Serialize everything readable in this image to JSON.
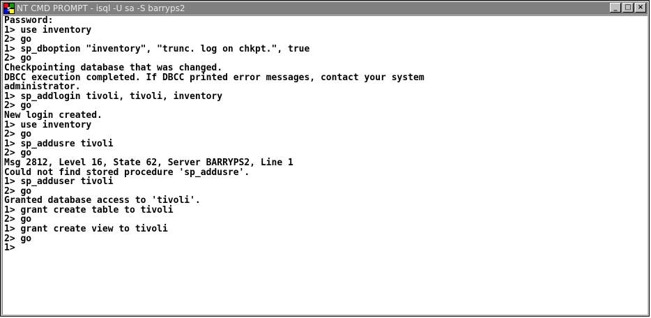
{
  "window": {
    "title": "NT CMD PROMPT - isql -U sa -S barryps2",
    "icon": "ms-dos-icon",
    "buttons": {
      "minimize": "_",
      "maximize": "□",
      "close": "×"
    }
  },
  "console": {
    "lines": [
      "Password:",
      "1> use inventory",
      "2> go",
      "1> sp_dboption \"inventory\", \"trunc. log on chkpt.\", true",
      "2> go",
      "Checkpointing database that was changed.",
      "DBCC execution completed. If DBCC printed error messages, contact your system",
      "administrator.",
      "1> sp_addlogin tivoli, tivoli, inventory",
      "2> go",
      "New login created.",
      "1> use inventory",
      "2> go",
      "1> sp_addusre tivoli",
      "2> go",
      "Msg 2812, Level 16, State 62, Server BARRYPS2, Line 1",
      "Could not find stored procedure 'sp_addusre'.",
      "1> sp_adduser tivoli",
      "2> go",
      "Granted database access to 'tivoli'.",
      "1> grant create table to tivoli",
      "2> go",
      "1> grant create view to tivoli",
      "2> go",
      "1>"
    ]
  }
}
